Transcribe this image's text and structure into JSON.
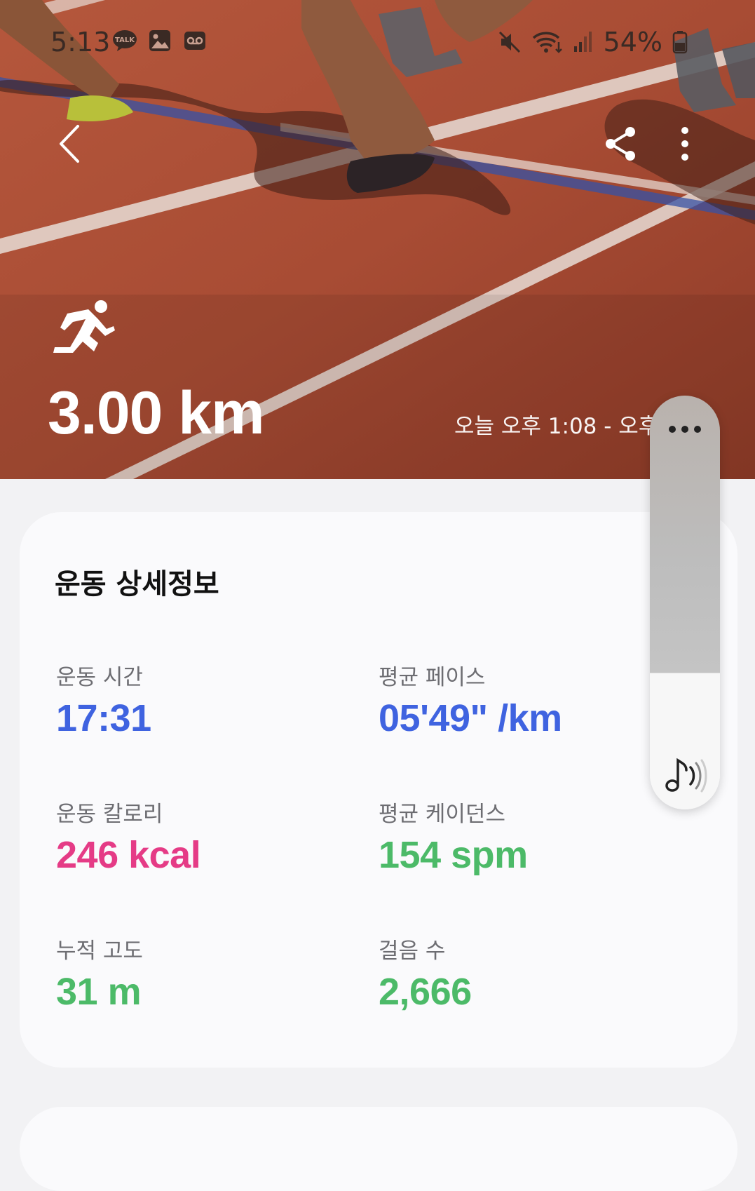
{
  "status_bar": {
    "time": "5:13",
    "battery": "54%",
    "left_icons": [
      "kakaotalk-icon",
      "gallery-icon",
      "voicemail-icon"
    ],
    "right_icons": [
      "mute-icon",
      "wifi-icon",
      "signal-icon",
      "battery-icon"
    ]
  },
  "hero": {
    "distance": "3.00 km",
    "time_range": "오늘 오후 1:08 - 오후"
  },
  "details": {
    "title": "운동 상세정보",
    "metrics": [
      {
        "label": "운동 시간",
        "value": "17:31",
        "color": "#3f63e0"
      },
      {
        "label": "평균 페이스",
        "value": "05'49\" /km",
        "color": "#3f63e0"
      },
      {
        "label": "운동 칼로리",
        "value": "246 kcal",
        "color": "#e53b86"
      },
      {
        "label": "평균 케이던스",
        "value": "154 spm",
        "color": "#4cba68"
      },
      {
        "label": "누적 고도",
        "value": "31 m",
        "color": "#4cba68"
      },
      {
        "label": "걸음 수",
        "value": "2,666",
        "color": "#4cba68"
      }
    ]
  },
  "colors": {
    "track": "#a44a33",
    "pace_blue": "#3f63e0",
    "calorie_pink": "#e53b86",
    "green": "#4cba68"
  }
}
